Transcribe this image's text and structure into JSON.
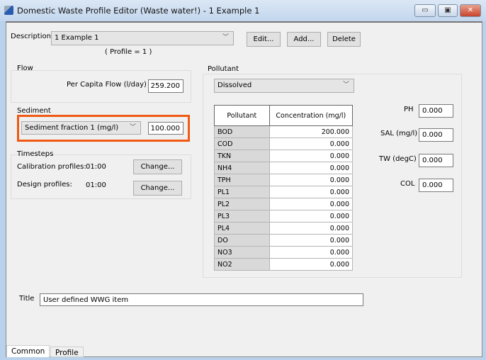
{
  "window": {
    "title": "Domestic Waste Profile Editor (Waste water!) - 1 Example 1",
    "minimize": "▭",
    "maximize": "▣",
    "close": "✕"
  },
  "description": {
    "label": "Description",
    "value": "1 Example 1",
    "profile_note": "( Profile = 1 )",
    "edit": "Edit...",
    "add": "Add...",
    "delete": "Delete"
  },
  "flow": {
    "group": "Flow",
    "label": "Per Capita Flow (l/day)",
    "value": "259.200"
  },
  "sediment": {
    "group": "Sediment",
    "select": "Sediment fraction 1 (mg/l)",
    "value": "100.000"
  },
  "timesteps": {
    "group": "Timesteps",
    "calibration_label": "Calibration profiles:",
    "calibration_value": "01:00",
    "design_label": "Design profiles:",
    "design_value": "01:00",
    "change": "Change..."
  },
  "pollutant": {
    "group": "Pollutant",
    "select": "Dissolved",
    "headers": [
      "Pollutant",
      "Concentration (mg/l)"
    ],
    "rows": [
      [
        "BOD",
        "200.000"
      ],
      [
        "COD",
        "0.000"
      ],
      [
        "TKN",
        "0.000"
      ],
      [
        "NH4",
        "0.000"
      ],
      [
        "TPH",
        "0.000"
      ],
      [
        "PL1",
        "0.000"
      ],
      [
        "PL2",
        "0.000"
      ],
      [
        "PL3",
        "0.000"
      ],
      [
        "PL4",
        "0.000"
      ],
      [
        "DO",
        "0.000"
      ],
      [
        "NO3",
        "0.000"
      ],
      [
        "NO2",
        "0.000"
      ]
    ]
  },
  "params": [
    {
      "label": "PH",
      "value": "0.000"
    },
    {
      "label": "SAL (mg/l)",
      "value": "0.000"
    },
    {
      "label": "TW (degC)",
      "value": "0.000"
    },
    {
      "label": "COL",
      "value": "0.000"
    }
  ],
  "title_field": {
    "label": "Title",
    "value": "User defined WWG item"
  },
  "tabs": [
    "Common",
    "Profile"
  ],
  "highlight_color": "#f05a14"
}
